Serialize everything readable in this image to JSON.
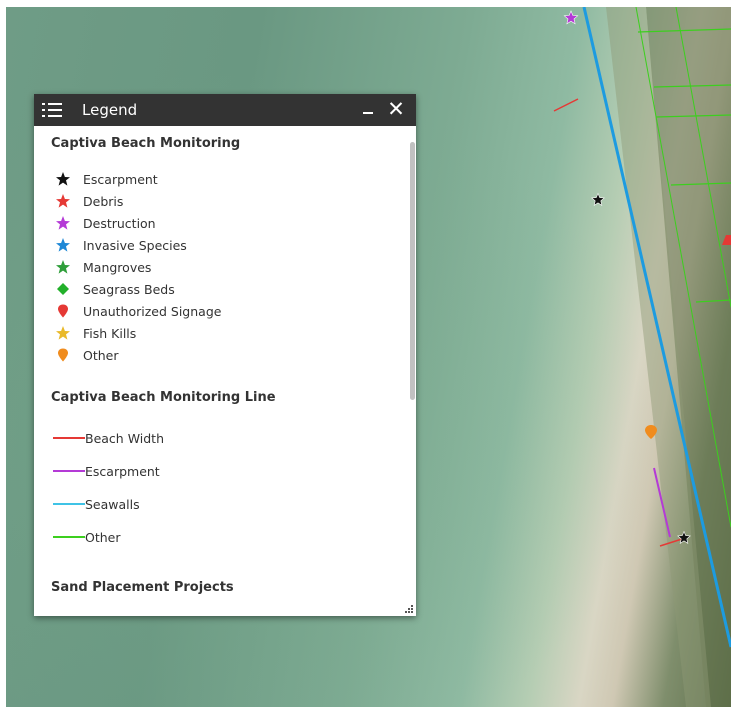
{
  "legend": {
    "title": "Legend",
    "minimize_label": "–",
    "close_label": "✕",
    "sections": [
      {
        "title": "Captiva Beach Monitoring",
        "items": [
          {
            "label": "Escarpment",
            "symbol": "star",
            "color": "#111111"
          },
          {
            "label": "Debris",
            "symbol": "star",
            "color": "#e53935"
          },
          {
            "label": "Destruction",
            "symbol": "star",
            "color": "#b43ad6"
          },
          {
            "label": "Invasive Species",
            "symbol": "star",
            "color": "#1e88d6"
          },
          {
            "label": "Mangroves",
            "symbol": "star",
            "color": "#2e9e3a"
          },
          {
            "label": "Seagrass Beds",
            "symbol": "diamond",
            "color": "#22b02a"
          },
          {
            "label": "Unauthorized Signage",
            "symbol": "pin",
            "color": "#e53935"
          },
          {
            "label": "Fish Kills",
            "symbol": "star",
            "color": "#e9b92a"
          },
          {
            "label": "Other",
            "symbol": "pin",
            "color": "#f08c1e"
          }
        ]
      },
      {
        "title": "Captiva Beach Monitoring Line",
        "items": [
          {
            "label": "Beach Width",
            "symbol": "line",
            "color": "#e53935"
          },
          {
            "label": "Escarpment",
            "symbol": "line",
            "color": "#b43ad6"
          },
          {
            "label": "Seawalls",
            "symbol": "line",
            "color": "#3fc3e6"
          },
          {
            "label": "Other",
            "symbol": "line",
            "color": "#3ccf1e"
          }
        ]
      },
      {
        "title": "Sand Placement Projects",
        "items": []
      }
    ]
  },
  "map": {
    "shoreline_line_color": "#1d9be0",
    "parcel_line_color": "#3ccf1e"
  }
}
